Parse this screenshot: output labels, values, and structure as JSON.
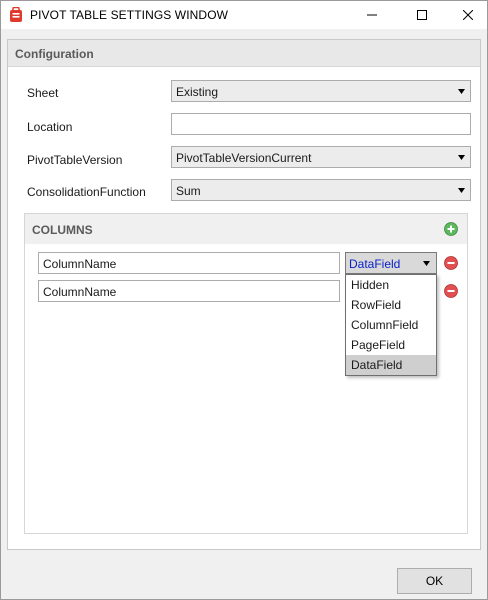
{
  "window": {
    "title": "PIVOT TABLE SETTINGS WINDOW"
  },
  "configuration": {
    "header": "Configuration",
    "fields": [
      {
        "label": "Sheet",
        "value": "Existing",
        "type": "select"
      },
      {
        "label": "Location",
        "value": "",
        "type": "text"
      },
      {
        "label": "PivotTableVersion",
        "value": "PivotTableVersionCurrent",
        "type": "select"
      },
      {
        "label": "ConsolidationFunction",
        "value": "Sum",
        "type": "select"
      }
    ]
  },
  "columns": {
    "header": "COLUMNS",
    "rows": [
      {
        "name": "ColumnName",
        "type": "DataField"
      },
      {
        "name": "ColumnName",
        "type": "DataField"
      }
    ],
    "dropdown_options": [
      "Hidden",
      "RowField",
      "ColumnField",
      "PageField",
      "DataField"
    ],
    "dropdown_selected": "DataField"
  },
  "footer": {
    "ok_label": "OK"
  },
  "colors": {
    "add_green": "#5cb85c",
    "remove_red": "#e05050",
    "selected_text_blue": "#0a22c8"
  },
  "icons": {
    "app": "app-icon",
    "minimize": "minimize-icon",
    "maximize": "maximize-icon",
    "close": "close-icon",
    "add": "add-icon",
    "remove": "remove-icon"
  }
}
